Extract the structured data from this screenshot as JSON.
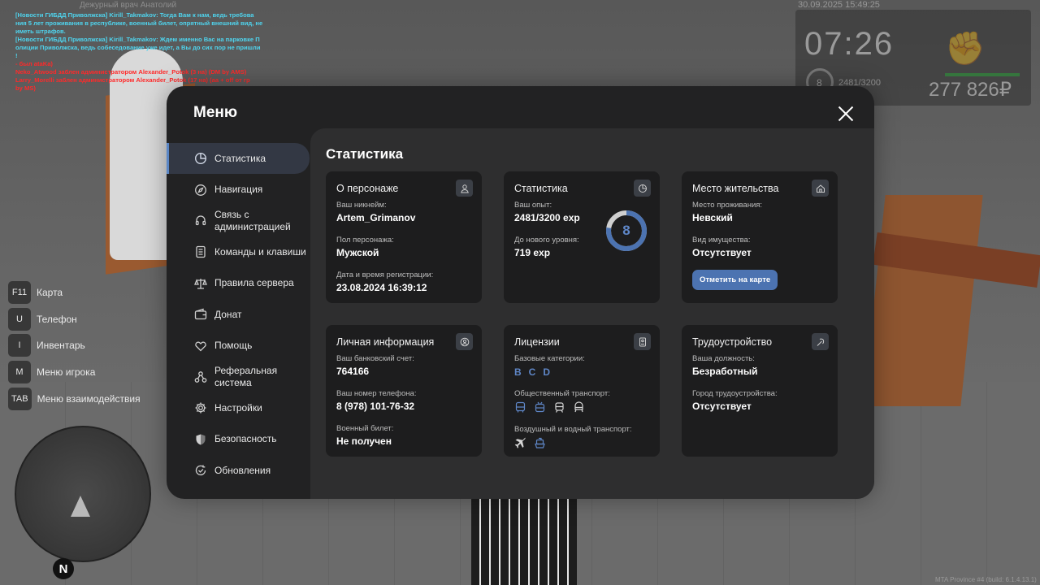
{
  "world": {
    "npc_name": "Дежурный врач Анатолий",
    "chat": [
      {
        "color": "cyan",
        "text": "[Новости ГИБДД Приволжска] Kirill_Takmakov: Тогда Вам к нам, ведь требова"
      },
      {
        "color": "cyan",
        "text": "ния 5 лет проживания в республике, военный билет, опрятный внешний вид, не"
      },
      {
        "color": "cyan",
        "text": " иметь штрафов."
      },
      {
        "color": "cyan",
        "text": "[Новости ГИБДД Приволжска] Kirill_Takmakov: Ждем именно Вас на парковке П"
      },
      {
        "color": "cyan",
        "text": "олиции Приволжска, ведь собеседование уже идет, а Вы до сих пор не пришли"
      },
      {
        "color": "cyan",
        "text": "!"
      },
      {
        "color": "red",
        "text": " - был ataKa)"
      },
      {
        "color": "red",
        "text": "Neko_Atwood заблен администратором Alexander_Potok (3 на) (DM by AMS)"
      },
      {
        "color": "red",
        "text": "Larry_Morelli заблен администратором Alexander_Potok (17 на) (aa + off от гр"
      },
      {
        "color": "red",
        "text": " by MS)"
      }
    ]
  },
  "hud": {
    "datetime": "30.09.2025 15:49:25",
    "time": "07:26",
    "level": "8",
    "exp": "2481/3200",
    "money": "277 826₽"
  },
  "hotkeys": [
    {
      "key": "F11",
      "label": "Карта"
    },
    {
      "key": "U",
      "label": "Телефон"
    },
    {
      "key": "I",
      "label": "Инвентарь"
    },
    {
      "key": "M",
      "label": "Меню игрока"
    },
    {
      "key": "TAB",
      "label": "Меню взаимодействия"
    }
  ],
  "minimap": {
    "north": "N"
  },
  "build": "MTA Province #4 (build: 6.1.4.13.1)",
  "menu": {
    "title": "Меню",
    "sidebar": [
      {
        "label": "Статистика",
        "icon": "pie-chart-icon",
        "active": true
      },
      {
        "label": "Навигация",
        "icon": "compass-icon"
      },
      {
        "label": "Связь с администрацией",
        "icon": "headset-icon"
      },
      {
        "label": "Команды и клавиши",
        "icon": "document-icon"
      },
      {
        "label": "Правила сервера",
        "icon": "scales-icon"
      },
      {
        "label": "Донат",
        "icon": "wallet-icon"
      },
      {
        "label": "Помощь",
        "icon": "heart-hand-icon"
      },
      {
        "label": "Реферальная система",
        "icon": "network-icon"
      },
      {
        "label": "Настройки",
        "icon": "gear-icon"
      },
      {
        "label": "Безопасность",
        "icon": "shield-icon"
      },
      {
        "label": "Обновления",
        "icon": "refresh-check-icon"
      }
    ],
    "content_title": "Статистика",
    "cards": {
      "character": {
        "title": "О персонаже",
        "nickname_label": "Ваш никнейм:",
        "nickname": "Artem_Grimanov",
        "gender_label": "Пол персонажа:",
        "gender": "Мужской",
        "reg_label": "Дата и время регистрации:",
        "reg": "23.08.2024 16:39:12"
      },
      "stats": {
        "title": "Статистика",
        "exp_label": "Ваш опыт:",
        "exp": "2481/3200 exp",
        "next_label": "До нового уровня:",
        "next": "719 exp",
        "level": "8",
        "progress": 0.775
      },
      "residence": {
        "title": "Место жительства",
        "place_label": "Место проживания:",
        "place": "Невский",
        "property_label": "Вид имущества:",
        "property": "Отсутствует",
        "button": "Отметить на карте"
      },
      "personal": {
        "title": "Личная информация",
        "bank_label": "Ваш банковский счет:",
        "bank": "764166",
        "phone_label": "Ваш номер телефона:",
        "phone": "8 (978) 101-76-32",
        "military_label": "Военный билет:",
        "military": "Не получен"
      },
      "licenses": {
        "title": "Лицензии",
        "base_label": "Базовые категории:",
        "base": [
          "B",
          "C",
          "D"
        ],
        "public_label": "Общественный транспорт:",
        "air_label": "Воздушный и водный транспорт:"
      },
      "employment": {
        "title": "Трудоустройство",
        "position_label": "Ваша должность:",
        "position": "Безработный",
        "city_label": "Город трудоустройства:",
        "city": "Отсутствует"
      }
    }
  }
}
